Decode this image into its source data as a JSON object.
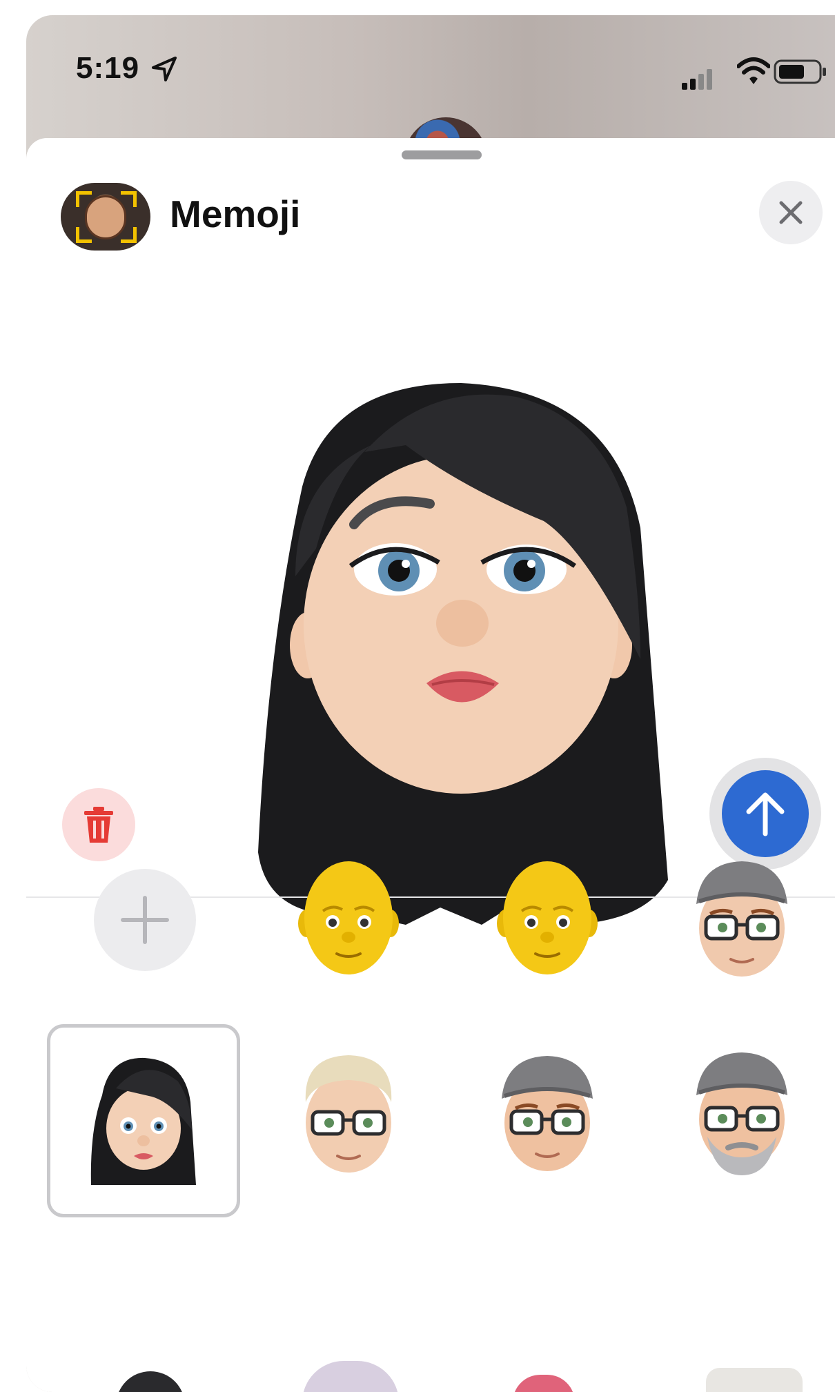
{
  "status_bar": {
    "time": "5:19"
  },
  "header": {
    "title": "Memoji"
  },
  "colors": {
    "send_blue": "#2d6ad2",
    "delete_red": "#e53b35",
    "delete_bg": "#fbdcdc"
  },
  "icons": {
    "location": "location-arrow-icon",
    "close": "close-icon",
    "delete": "trash-icon",
    "send": "arrow-up-icon",
    "add": "plus-icon"
  },
  "memoji_grid": {
    "selected_index": 4,
    "items": [
      {
        "kind": "add"
      },
      {
        "kind": "yellow-bald"
      },
      {
        "kind": "yellow-bald"
      },
      {
        "kind": "gray-cap-glasses"
      },
      {
        "kind": "black-hair-woman"
      },
      {
        "kind": "blond-glasses"
      },
      {
        "kind": "gray-cap-glasses"
      },
      {
        "kind": "gray-cap-glasses-beard"
      }
    ]
  }
}
